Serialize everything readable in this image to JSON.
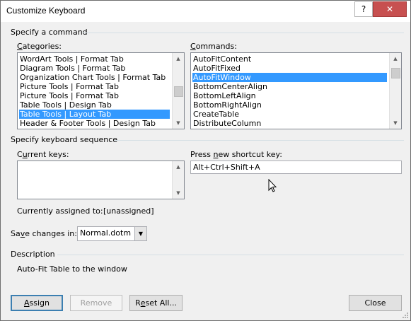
{
  "window": {
    "title": "Customize Keyboard",
    "help_label": "?",
    "close_label": "✕"
  },
  "specify_command": {
    "group_label": "Specify a command",
    "categories": {
      "label": "Categories:",
      "items": [
        "WordArt Tools | Format Tab",
        "Diagram Tools | Format Tab",
        "Organization Chart Tools | Format Tab",
        "Picture Tools | Format Tab",
        "Picture Tools | Format Tab",
        "Table Tools | Design Tab",
        "Table Tools | Layout Tab",
        "Header & Footer Tools | Design Tab"
      ],
      "selected_index": 6
    },
    "commands": {
      "label": "Commands:",
      "items": [
        "AutoFitContent",
        "AutoFitFixed",
        "AutoFitWindow",
        "BottomCenterAlign",
        "BottomLeftAlign",
        "BottomRightAlign",
        "CreateTable",
        "DistributeColumn"
      ],
      "selected_index": 2
    }
  },
  "keyboard_sequence": {
    "group_label": "Specify keyboard sequence",
    "current_keys_label": "Current keys:",
    "new_shortcut_label": "Press new shortcut key:",
    "new_shortcut_value": "Alt+Ctrl+Shift+A",
    "assigned_label": "Currently assigned to:",
    "assigned_value": "[unassigned]"
  },
  "save_changes": {
    "label": "Save changes in:",
    "value": "Normal.dotm"
  },
  "description": {
    "group_label": "Description",
    "text": "Auto-Fit Table to the window"
  },
  "buttons": {
    "assign": "Assign",
    "remove": "Remove",
    "reset_all": "Reset All...",
    "close": "Close"
  }
}
